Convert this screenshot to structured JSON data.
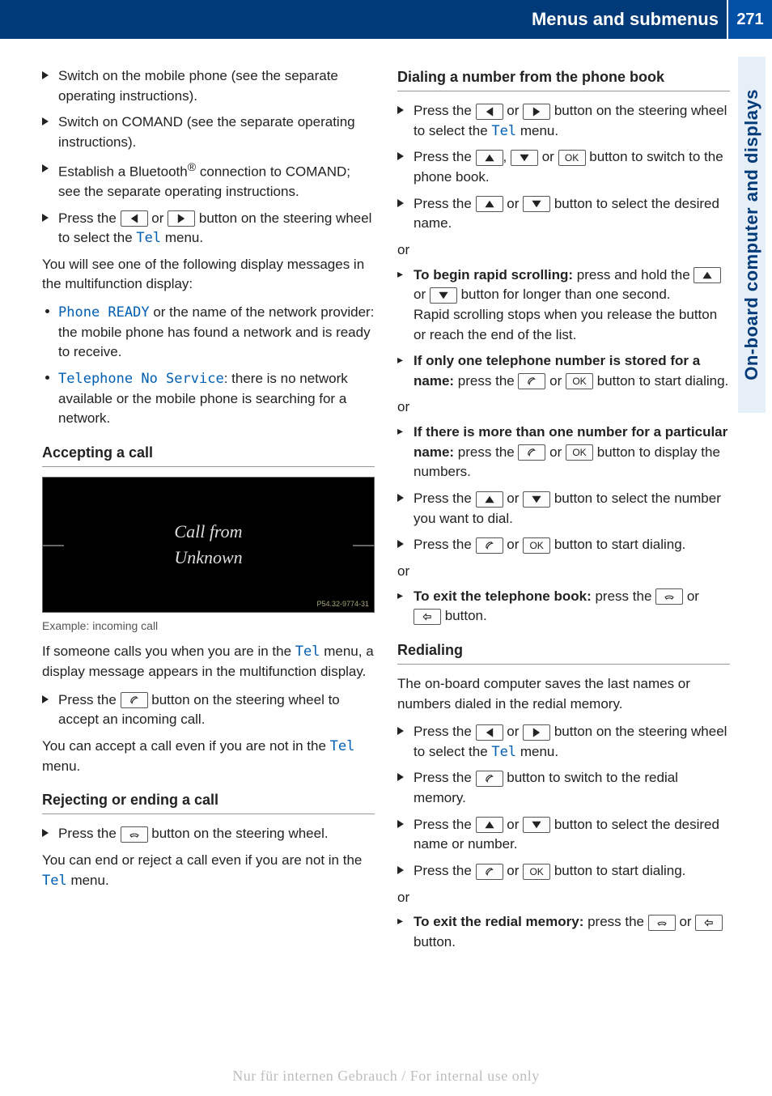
{
  "header": {
    "title": "Menus and submenus",
    "page": "271"
  },
  "side_tab": "On-board computer and displays",
  "left": {
    "bullets1": [
      "Switch on the mobile phone (see the separate operating instructions).",
      "Switch on COMAND (see the separate operating instructions)."
    ],
    "establish_pre": "Establish a Bluetooth",
    "establish_post": " connection to COMAND; see the separate operating instructions.",
    "press_tel_pre": "Press the ",
    "press_tel_mid": " or ",
    "press_tel_end1": " button on the steering wheel to select the ",
    "tel": "Tel",
    "press_tel_end2": " menu.",
    "following": "You will see one of the following display messages in the multifunction display:",
    "phone_ready": "Phone READY",
    "phone_ready_rest": " or the name of the network provider: the mobile phone has found a network and is ready to receive.",
    "no_service": "Telephone No Service",
    "no_service_rest": ": there is no network available or the mobile phone is searching for a network.",
    "accepting_heading": "Accepting a call",
    "display_line1": "Call from",
    "display_line2": "Unknown",
    "caption": "Example: incoming call",
    "if_someone_pre": "If someone calls you when you are in the ",
    "if_someone_post": " menu, a display message appears in the multifunction display.",
    "accept_call_pre": "Press the ",
    "accept_call_post": " button on the steering wheel to accept an incoming call.",
    "can_accept_pre": "You can accept a call even if you are not in the ",
    "can_accept_post": " menu.",
    "reject_heading": "Rejecting or ending a call",
    "reject_pre": "Press the ",
    "reject_post": " button on the steering wheel.",
    "can_end_pre": "You can end or reject a call even if you are not in the ",
    "can_end_post": " menu."
  },
  "right": {
    "dial_heading": "Dialing a number from the phone book",
    "r1_pre": "Press the ",
    "r1_or": " or ",
    "r1_mid": " button on the steering wheel to select the ",
    "r1_end": " menu.",
    "r2_pre": "Press the ",
    "r2_c": ", ",
    "r2_or": " or ",
    "r2_end": " button to switch to the phone book.",
    "r3_pre": "Press the ",
    "r3_or": " or ",
    "r3_end": " button to select the desired name.",
    "or": "or",
    "rapid_b": "To begin rapid scrolling:",
    "rapid_pre": " press and hold the ",
    "rapid_or": " or ",
    "rapid_end": " button for longer than one second.",
    "rapid_line2": "Rapid scrolling stops when you release the button or reach the end of the list.",
    "only_one_b": "If only one telephone number is stored for a name:",
    "only_one_pre": " press the ",
    "only_one_or": " or ",
    "only_one_end": " button to start dialing.",
    "more_b": "If there is more than one number for a particular name:",
    "more_pre": " press the ",
    "more_or": " or ",
    "more_end": " button to display the numbers.",
    "r6_pre": "Press the ",
    "r6_or": " or ",
    "r6_end": " button to select the number you want to dial.",
    "r7_pre": "Press the ",
    "r7_or": " or ",
    "r7_end": " button to start dialing.",
    "exit_b": "To exit the telephone book:",
    "exit_pre": " press the ",
    "exit_or": " or ",
    "exit_end": " button.",
    "redial_heading": "Redialing",
    "redial_intro": "The on-board computer saves the last names or numbers dialed in the redial memory.",
    "rd1_pre": "Press the ",
    "rd1_or": " or ",
    "rd1_mid": " button on the steering wheel to select the ",
    "rd1_end": " menu.",
    "rd2_pre": "Press the ",
    "rd2_end": " button to switch to the redial memory.",
    "rd3_pre": "Press the ",
    "rd3_or": " or ",
    "rd3_end": " button to select the desired name or number.",
    "rd4_pre": "Press the ",
    "rd4_or": " or ",
    "rd4_end": " button to start dialing.",
    "rexit_b": "To exit the redial memory:",
    "rexit_pre": " press the ",
    "rexit_or": " or ",
    "rexit_end": " button."
  },
  "keys": {
    "ok": "OK"
  },
  "footer": "Nur für internen Gebrauch / For internal use only"
}
